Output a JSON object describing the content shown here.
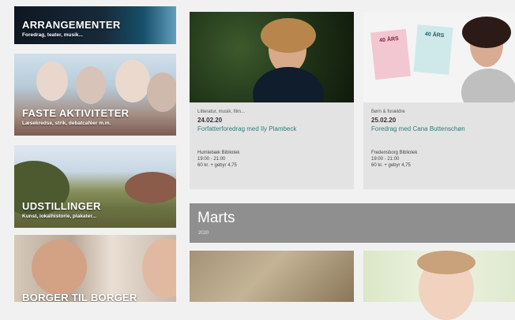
{
  "sidebar": {
    "tiles": [
      {
        "title": "ARRANGEMENTER",
        "subtitle": "Foredrag, teater, musik..."
      },
      {
        "title": "FASTE AKTIVITETER",
        "subtitle": "Læsekredse, strik, debatcaféer m.m."
      },
      {
        "title": "UDSTILLINGER",
        "subtitle": "Kunst, lokalhistorie, plakater..."
      },
      {
        "title": "BORGER TIL BORGER",
        "subtitle": ""
      }
    ]
  },
  "events": [
    {
      "category": "Litteratur, musik, film...",
      "date": "24.02.20",
      "title": "Forfatterforedrag med Ily Plambeck",
      "venue": "Humlebæk Bibliotek",
      "time": "19:00 - 21:00",
      "price": "60 kr. + gebyr 4,75",
      "book_label_1": "40 ÅRS",
      "book_label_2": "40 ÅRS"
    },
    {
      "category": "Børn & forældre",
      "date": "25.02.20",
      "title": "Foredrag med Cana Buttenschøn",
      "venue": "Fredensborg Bibliotek",
      "time": "19:00 - 21:00",
      "price": "60 kr. + gebyr 4,75"
    }
  ],
  "month_banner": {
    "month": "Marts",
    "year": "2020"
  }
}
